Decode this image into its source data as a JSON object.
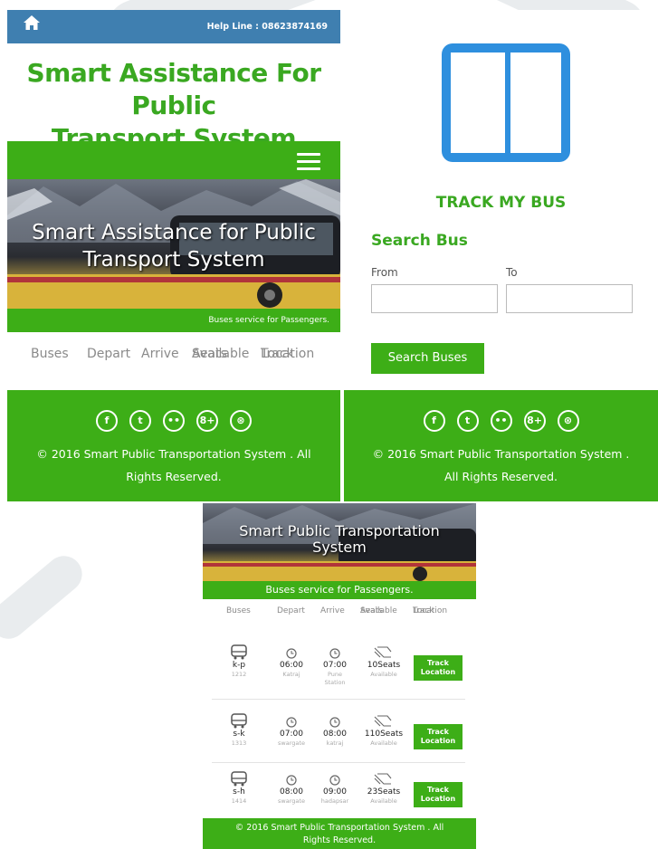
{
  "screen1": {
    "helpline": "Help Line : 08623874169",
    "title_line1": "Smart Assistance For Public",
    "title_line2": "Transport System",
    "hero_line1": "Smart Assistance for Public",
    "hero_line2": "Transport System",
    "hero_caption": "Buses service for Passengers.",
    "columns": {
      "buses": "Buses",
      "depart": "Depart",
      "arrive": "Arrive",
      "seats_line1": "Available",
      "seats_line2": "Seats",
      "track_line1": "Track",
      "track_line2": "Location"
    },
    "copyright_line1": "© 2016 Smart Public Transportation System . All",
    "copyright_line2": "Rights Reserved."
  },
  "screen2": {
    "track_title": "TRACK MY BUS",
    "search_title": "Search Bus",
    "from_label": "From",
    "to_label": "To",
    "from_value": "",
    "to_value": "",
    "search_button": "Search Buses",
    "copyright_line1": "© 2016 Smart Public Transportation System .",
    "copyright_line2": "All Rights Reserved."
  },
  "screen3": {
    "hero_line1": "Smart Public Transportation",
    "hero_line2": "System",
    "hero_caption": "Buses service for Passengers.",
    "columns": {
      "buses": "Buses",
      "depart": "Depart",
      "arrive": "Arrive",
      "seats_line1": "Available",
      "seats_line2": "Seats",
      "track_line1": "Track",
      "track_line2": "Location"
    },
    "rows": [
      {
        "bus": "k-p",
        "bus_no": "1212",
        "depart": "06:00",
        "depart_place": "Katraj",
        "arrive": "07:00",
        "arrive_place_line1": "Pune",
        "arrive_place_line2": "Station",
        "seats": "10Seats",
        "seats_sub": "Available",
        "track_line1": "Track",
        "track_line2": "Location"
      },
      {
        "bus": "s-k",
        "bus_no": "1313",
        "depart": "07:00",
        "depart_place": "swargate",
        "arrive": "08:00",
        "arrive_place_line1": "katraj",
        "arrive_place_line2": "",
        "seats": "110Seats",
        "seats_sub": "Available",
        "track_line1": "Track",
        "track_line2": "Location"
      },
      {
        "bus": "s-h",
        "bus_no": "1414",
        "depart": "08:00",
        "depart_place": "swargate",
        "arrive": "09:00",
        "arrive_place_line1": "hadapsar",
        "arrive_place_line2": "",
        "seats": "23Seats",
        "seats_sub": "Available",
        "track_line1": "Track",
        "track_line2": "Location"
      }
    ],
    "copyright_line1": "© 2016 Smart Public Transportation System . All",
    "copyright_line2": "Rights Reserved."
  },
  "social_icons": [
    "facebook-icon",
    "twitter-icon",
    "flickr-icon",
    "google-plus-icon",
    "dribbble-icon"
  ],
  "social_glyphs": [
    "f",
    "t",
    "••",
    "8+",
    "⊛"
  ],
  "colors": {
    "green": "#3dae17",
    "title_green": "#3aa821",
    "topbar_blue": "#3f7fb0",
    "logo_blue": "#2e8fde"
  }
}
